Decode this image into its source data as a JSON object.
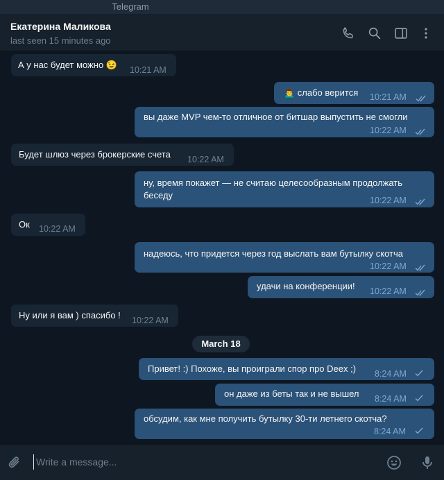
{
  "window_title": "Telegram",
  "chat": {
    "name": "Екатерина Маликова",
    "status": "last seen 15 minutes ago"
  },
  "icons": {
    "call": "phone-icon",
    "search": "search-icon",
    "sidebar": "sidebar-toggle-icon",
    "menu": "more-vertical-icon",
    "attach": "paperclip-icon",
    "emoji": "smile-icon",
    "mic": "microphone-icon"
  },
  "messages": [
    {
      "dir": "in",
      "text": "А у нас будет можно 😉",
      "time": "10:21 AM"
    },
    {
      "dir": "out",
      "text": "🙍‍♂️ слабо верится",
      "time": "10:21 AM",
      "read": true
    },
    {
      "dir": "out",
      "text": "вы даже MVP чем-то отличное от битшар выпустить не смогли",
      "time": "10:22 AM",
      "read": true
    },
    {
      "dir": "in",
      "text": "Будет шлюз через брокерские счета",
      "time": "10:22 AM"
    },
    {
      "dir": "out",
      "text": "ну, время покажет — не считаю целесообразным продолжать",
      "text2": "беседу",
      "time": "10:22 AM",
      "read": true
    },
    {
      "dir": "in",
      "text": "Ок",
      "time": "10:22 AM"
    },
    {
      "dir": "out",
      "text": "надеюсь, что придется через год выслать вам бутылку скотча",
      "time": "10:22 AM",
      "read": true
    },
    {
      "dir": "out",
      "text": "удачи на конференции!",
      "time": "10:22 AM",
      "read": true
    },
    {
      "dir": "in",
      "text": "Ну или я вам ) спасибо !",
      "time": "10:22 AM"
    },
    {
      "dir": "out",
      "text": "Привет! :) Похоже, вы проиграли спор про Deex ;)",
      "time": "8:24 AM",
      "read": false
    },
    {
      "dir": "out",
      "text": "он даже из беты так и не вышел",
      "time": "8:24 AM",
      "read": false
    },
    {
      "dir": "out",
      "text": "обсудим, как мне получить бутылку 30-ти летнего скотча?",
      "time": "8:24 AM",
      "read": false
    }
  ],
  "date_separator": "March 18",
  "composer": {
    "placeholder": "Write a message..."
  },
  "colors": {
    "background": "#0e1621",
    "header": "#17212b",
    "incoming_bubble": "#182533",
    "outgoing_bubble": "#2b5278",
    "check": "#7da8d3"
  }
}
